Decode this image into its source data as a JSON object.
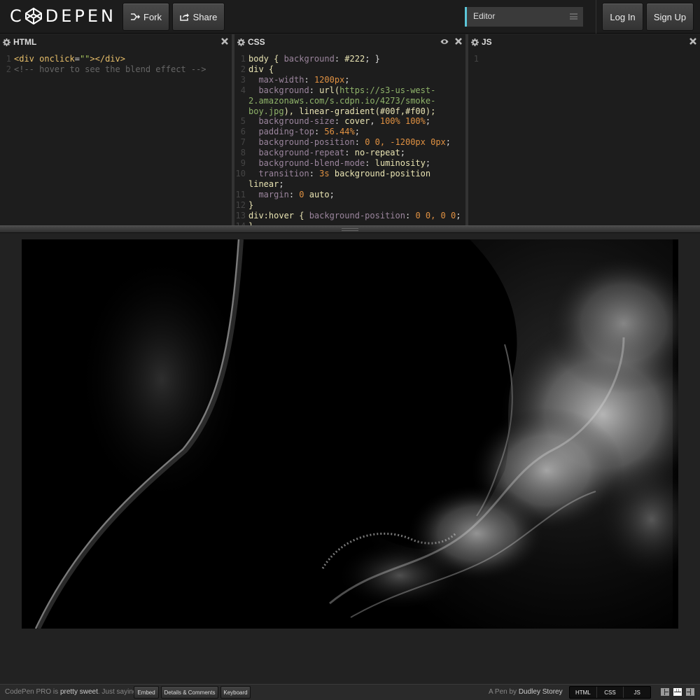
{
  "header": {
    "logo_text": "CODEPEN",
    "fork_label": "Fork",
    "share_label": "Share",
    "editor_select_value": "Editor",
    "login_label": "Log In",
    "signup_label": "Sign Up",
    "accent_color": "#5bc6d9"
  },
  "panes": {
    "html_title": "HTML",
    "css_title": "CSS",
    "js_title": "JS"
  },
  "html_code": {
    "line1_tag_open": "<div ",
    "line1_attr": "onclick",
    "line1_eq": "=",
    "line1_str": "\"\"",
    "line1_tag_close": "></div>",
    "line2_comment": "<!-- hover to see the blend effect -->"
  },
  "css_code": {
    "l1_sel": "body { ",
    "l1_prop": "background",
    "l1_colon": ": ",
    "l1_val": "#222",
    "l1_end": "; }",
    "l2": "div {",
    "l3_prop": "max-width",
    "l3_val": "1200px",
    "l4_prop": "background",
    "l4_fn": "url(",
    "l4_url": "https://s3-us-west-2.amazonaws.com/s.cdpn.io/4273/smoke-boy.jpg",
    "l4_rest": "), linear-gradient(#00f,#f00);",
    "l5_prop": "background-size",
    "l5_val1": "cover",
    "l5_val2": "100% 100%",
    "l6_prop": "padding-top",
    "l6_val": "56.44%",
    "l7_prop": "background-position",
    "l7_val": "0 0, -1200px 0px",
    "l8_prop": "background-repeat",
    "l8_val": "no-repeat",
    "l9_prop": "background-blend-mode",
    "l9_val": "luminosity",
    "l10_prop": "transition",
    "l10_val1": "3s",
    "l10_val2": "background-position linear",
    "l11_prop": "margin",
    "l11_val1": "0",
    "l11_val2": "auto",
    "l12": "}",
    "l13_sel": "div:hover { ",
    "l13_prop": "background-position",
    "l13_val": "0 0, 0 0",
    "l13_end": ";",
    "l14": "}"
  },
  "js_code": {
    "line_number": "1"
  },
  "preview": {
    "image_description_icon": "smoke-portrait-image"
  },
  "footer": {
    "promo_prefix": "CodePen PRO is ",
    "promo_bold": "pretty sweet",
    "promo_suffix": ". Just saying.",
    "embed_label": "Embed",
    "details_label": "Details & Comments",
    "keyboard_label": "Keyboard",
    "author_prefix": "A Pen by ",
    "author_name": "Dudley Storey",
    "view_html": "HTML",
    "view_css": "CSS",
    "view_js": "JS"
  }
}
